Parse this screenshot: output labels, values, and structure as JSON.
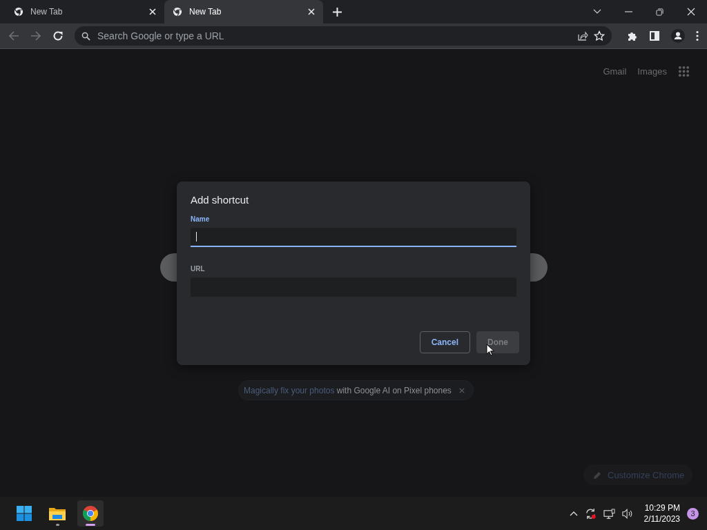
{
  "tabs": [
    {
      "title": "New Tab",
      "selected": false
    },
    {
      "title": "New Tab",
      "selected": true
    }
  ],
  "address_bar": {
    "placeholder": "Search Google or type a URL"
  },
  "header_links": [
    "Gmail",
    "Images"
  ],
  "dialog": {
    "title": "Add shortcut",
    "fields": [
      {
        "label": "Name",
        "focused": true
      },
      {
        "label": "URL",
        "focused": false
      }
    ],
    "buttons": [
      {
        "label": "Cancel",
        "kind": "secondary",
        "disabled": false
      },
      {
        "label": "Done",
        "kind": "primary",
        "disabled": true
      }
    ]
  },
  "promo": {
    "link": "Magically fix your photos",
    "text": " with Google AI on Pixel phones"
  },
  "customize_button": {
    "label": "Customize Chrome"
  },
  "taskbar": {
    "apps": [
      {
        "kind": "start",
        "active": false
      },
      {
        "kind": "files",
        "active": false
      },
      {
        "kind": "chrome",
        "active": true
      }
    ],
    "time": "10:29 PM",
    "date": "2/11/2023",
    "notifications": "3"
  }
}
